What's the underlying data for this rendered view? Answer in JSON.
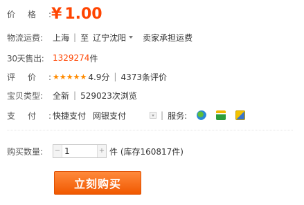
{
  "price": {
    "label": "价格:",
    "currency": "¥",
    "value": "1.00"
  },
  "logistics": {
    "label": "物流运费:",
    "from": "上海",
    "to_prefix": "至",
    "to": "辽宁沈阳",
    "shipping_note": "卖家承担运费"
  },
  "sales": {
    "label": "30天售出:",
    "count": "1329274",
    "unit": "件"
  },
  "review": {
    "label": "评价:",
    "stars": "★★★★★",
    "score": "4.9分",
    "count_text": "4373条评价"
  },
  "item_type": {
    "label": "宝贝类型:",
    "condition": "全新",
    "views": "529023次浏览"
  },
  "payment": {
    "label": "支付:",
    "method1": "快捷支付",
    "method2": "网银支付",
    "service_label": "服务:"
  },
  "quantity": {
    "label": "购买数量:",
    "value": "1",
    "minus": "−",
    "plus": "+",
    "stock": "件 (库存160817件)"
  },
  "buy_button": "立刻购买"
}
